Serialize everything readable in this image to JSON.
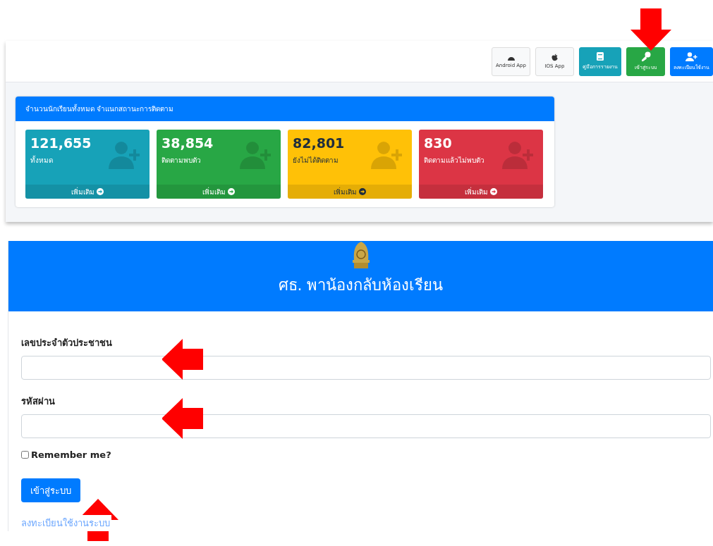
{
  "top_buttons": [
    {
      "label": "Android App",
      "kind": "light"
    },
    {
      "label": "IOS App",
      "kind": "light"
    },
    {
      "label": "คู่มือการรายงาน",
      "kind": "info"
    },
    {
      "label": "เข้าสู่ระบบ",
      "kind": "success"
    },
    {
      "label": "ลงทะเบียนใช้งาน",
      "kind": "primary"
    }
  ],
  "stats_card": {
    "title": "จำนวนนักเรียนทั้งหมด จำแนกสถานะการติดตาม",
    "boxes": [
      {
        "value": "121,655",
        "label": "ทั้งหมด",
        "more": "เพิ่มเติม",
        "color": "#17a2b8"
      },
      {
        "value": "38,854",
        "label": "ติดตามพบตัว",
        "more": "เพิ่มเติม",
        "color": "#28a745"
      },
      {
        "value": "82,801",
        "label": "ยังไม่ได้ติดตาม",
        "more": "เพิ่มเติม",
        "color": "#ffc107"
      },
      {
        "value": "830",
        "label": "ติดตามแล้วไม่พบตัว",
        "more": "เพิ่มเติม",
        "color": "#dc3545"
      }
    ]
  },
  "login": {
    "title": "ศธ. พาน้องกลับห้องเรียน",
    "fields": [
      {
        "label": "เลขประจำตัวประชาชน"
      },
      {
        "label": "รหัสผ่าน"
      }
    ],
    "remember": {
      "label": "Remember me?",
      "checked": false
    },
    "submit": "เข้าสู่ระบบ",
    "register_link": "ลงทะเบียนใช้งานระบบ"
  }
}
